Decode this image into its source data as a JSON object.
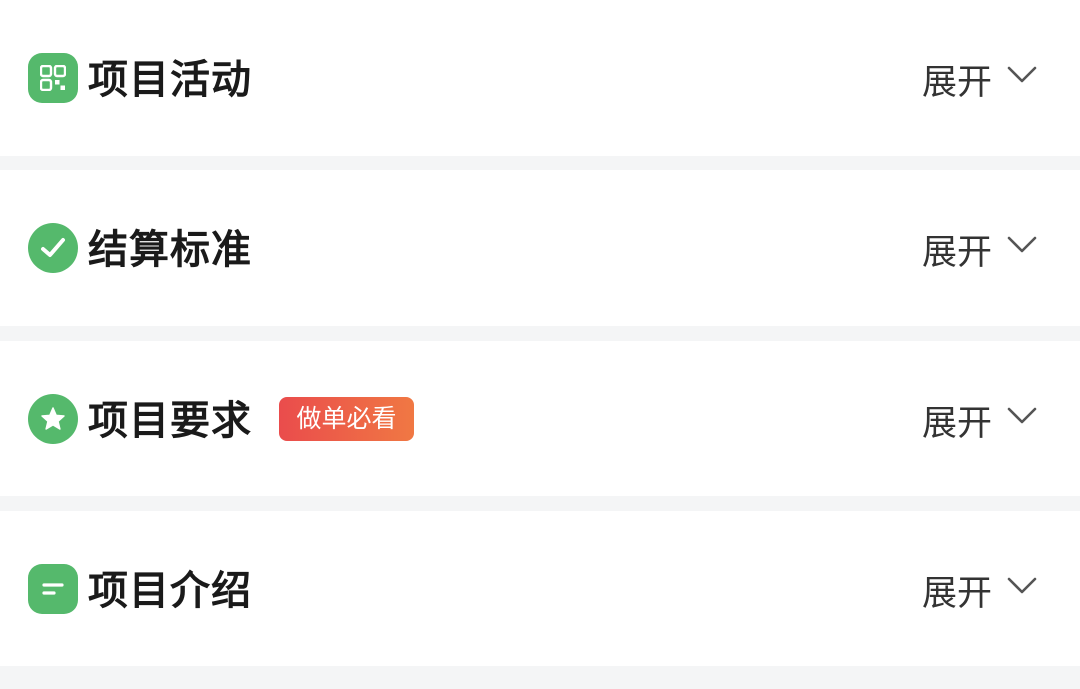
{
  "sections": [
    {
      "title": "项目活动",
      "expand_label": "展开",
      "icon": "qr-grid-icon"
    },
    {
      "title": "结算标准",
      "expand_label": "展开",
      "icon": "checkmark-icon"
    },
    {
      "title": "项目要求",
      "expand_label": "展开",
      "icon": "star-icon",
      "badge": "做单必看"
    },
    {
      "title": "项目介绍",
      "expand_label": "展开",
      "icon": "document-lines-icon"
    }
  ],
  "colors": {
    "icon_green": "#55b96c",
    "badge_gradient_start": "#ea4c4c",
    "badge_gradient_end": "#f07843",
    "page_background": "#f4f5f6",
    "card_background": "#ffffff"
  }
}
